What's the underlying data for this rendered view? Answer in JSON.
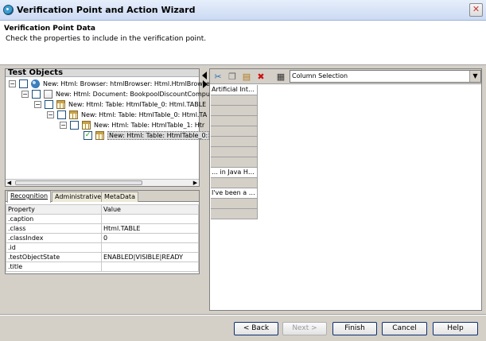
{
  "window": {
    "title": "Verification Point and Action Wizard",
    "close_glyph": "✕"
  },
  "header": {
    "title": "Verification Point Data",
    "description": "Check the properties to include in the verification point."
  },
  "tree": {
    "header": "Test Objects",
    "items": [
      {
        "label": "New: Html: Browser: htmlBrowser: Html.HtmlBrowse",
        "icon": "globe-icon",
        "expand": "−",
        "checked": false
      },
      {
        "label": "New: Html: Document: BookpoolDiscountComput",
        "icon": "document-icon",
        "expand": "−",
        "checked": false
      },
      {
        "label": "New: Html: Table: HtmlTable_0: Html.TABLE",
        "icon": "table-icon",
        "expand": "−",
        "checked": false
      },
      {
        "label": "New: Html: Table: HtmlTable_0: Html.TA",
        "icon": "table-icon",
        "expand": "−",
        "checked": false
      },
      {
        "label": "New: Html: Table: HtmlTable_1: Htr",
        "icon": "table-icon",
        "expand": "−",
        "checked": false
      },
      {
        "label": "New: Html: Table: HtmlTable_0:",
        "icon": "table-icon",
        "expand": "",
        "checked": true
      }
    ]
  },
  "tabs": [
    "Recognition",
    "Administrative",
    "MetaData"
  ],
  "properties": {
    "headers": [
      "Property",
      "Value"
    ],
    "rows": [
      [
        ".caption",
        ""
      ],
      [
        ".class",
        "Html.TABLE"
      ],
      [
        ".classIndex",
        "0"
      ],
      [
        ".id",
        ""
      ],
      [
        ".testObjectState",
        "ENABLED|VISIBLE|READY"
      ],
      [
        ".title",
        ""
      ]
    ]
  },
  "right": {
    "selection_mode": "Column Selection",
    "cells": [
      "Artificial Int…",
      "",
      "",
      "",
      "",
      "",
      "",
      "",
      "… in Java H…",
      "",
      "I've been a …",
      "",
      ""
    ]
  },
  "buttons": {
    "back": "< Back",
    "next": "Next >",
    "finish": "Finish",
    "cancel": "Cancel",
    "help": "Help"
  },
  "colors": {
    "header_bg": "#ffffff",
    "dialog_bg": "#d4d0c8",
    "button_border": "#0b2e74",
    "delete_icon": "#cc1111"
  }
}
